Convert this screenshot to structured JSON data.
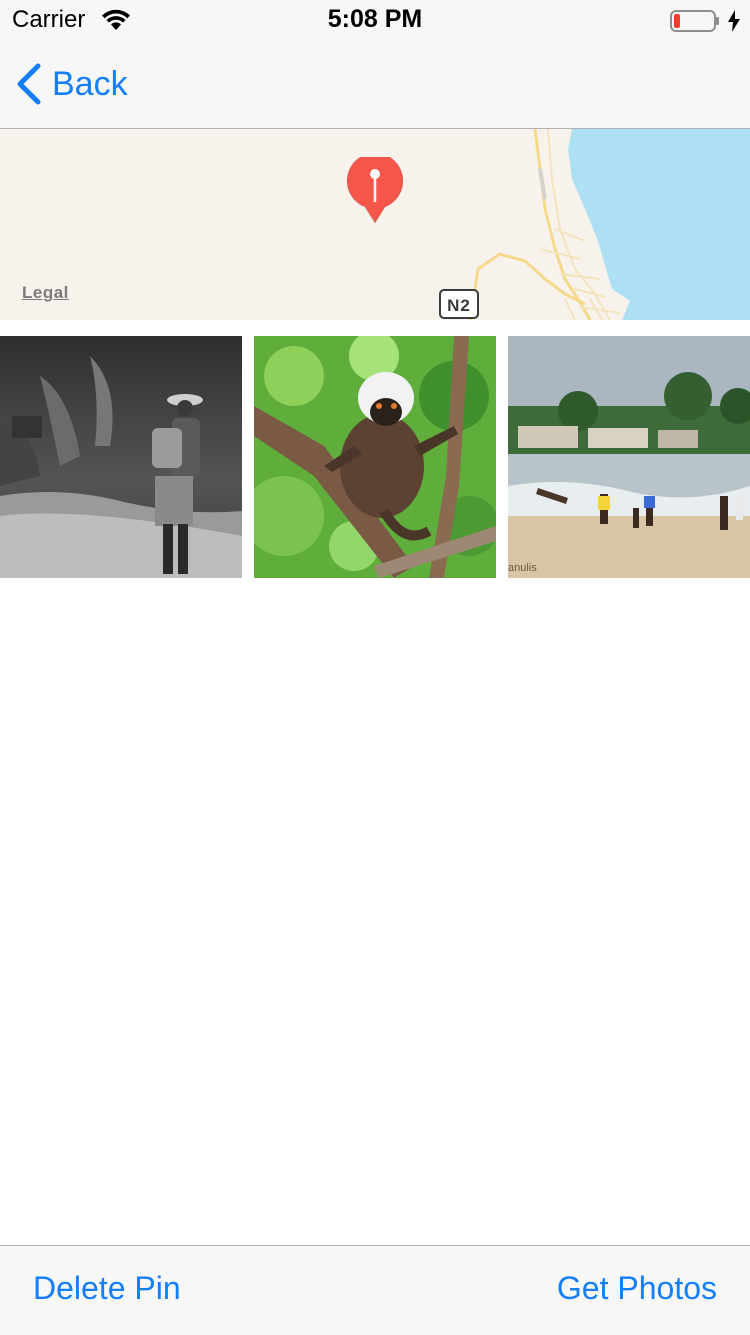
{
  "status_bar": {
    "carrier": "Carrier",
    "time": "5:08 PM",
    "battery_level": 0.15
  },
  "nav": {
    "back_label": "Back"
  },
  "map": {
    "legal_label": "Legal",
    "road_shield": "N2",
    "pin_color": "#f4564a",
    "water_color": "#aee0f3",
    "land_color": "#f7f3ec"
  },
  "photos": [
    {
      "subject": "grayscale person walking on path"
    },
    {
      "subject": "lemur in tree"
    },
    {
      "subject": "children on beach",
      "watermark": "anulis"
    }
  ],
  "toolbar": {
    "delete_label": "Delete Pin",
    "get_photos_label": "Get Photos"
  },
  "accent_color": "#147efb"
}
